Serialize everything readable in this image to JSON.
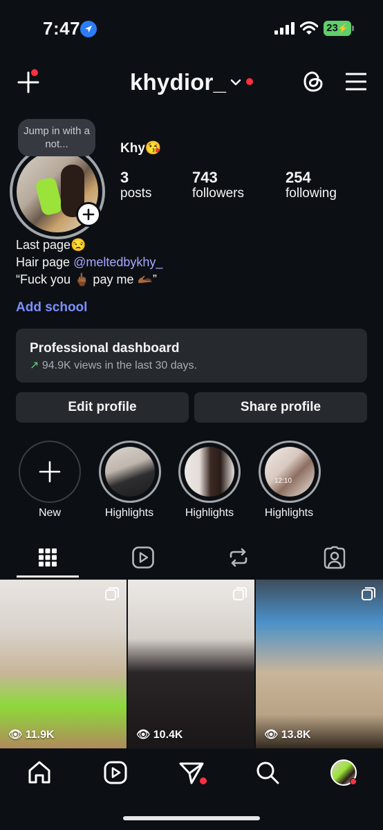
{
  "status_bar": {
    "time": "7:47",
    "battery": "23"
  },
  "header": {
    "username": "khydior_"
  },
  "profile": {
    "note_bubble": "Jump in with a not...",
    "display_name": "Khy😘",
    "stats": [
      {
        "value": "3",
        "label": "posts"
      },
      {
        "value": "743",
        "label": "followers"
      },
      {
        "value": "254",
        "label": "following"
      }
    ],
    "bio": {
      "line1": "Last page😒",
      "line2_prefix": "Hair page ",
      "line2_link": "@meltedbykhy_",
      "line3": "“Fuck you 🖕🏾 pay me 🫴🏾”"
    },
    "add_school": "Add school"
  },
  "dashboard": {
    "title": "Professional dashboard",
    "arrow": "↗",
    "subtitle": "94.9K views in the last 30 days."
  },
  "buttons": {
    "edit": "Edit profile",
    "share": "Share profile"
  },
  "highlights": [
    {
      "label": "New"
    },
    {
      "label": "Highlights"
    },
    {
      "label": "Highlights"
    },
    {
      "label": "Highlights"
    }
  ],
  "highlight_time_overlay": "12:10",
  "posts": [
    {
      "views": "11.9K"
    },
    {
      "views": "10.4K"
    },
    {
      "views": "13.8K"
    }
  ],
  "colors": {
    "background": "#0c1014",
    "surface": "#262a2f",
    "link": "#7c90ff",
    "notification": "#ff3040"
  }
}
